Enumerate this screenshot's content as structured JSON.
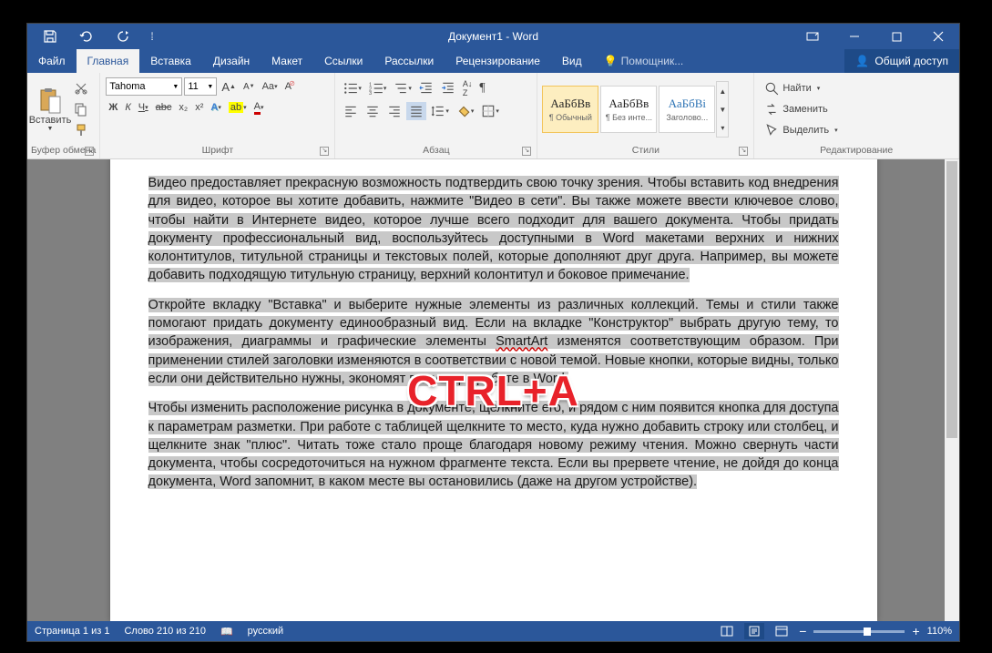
{
  "title": "Документ1 - Word",
  "tabs": {
    "file": "Файл",
    "home": "Главная",
    "insert": "Вставка",
    "design": "Дизайн",
    "layout": "Макет",
    "references": "Ссылки",
    "mailings": "Рассылки",
    "review": "Рецензирование",
    "view": "Вид",
    "tell": "Помощник...",
    "share": "Общий доступ"
  },
  "ribbon": {
    "clipboard": {
      "label": "Буфер обмена",
      "paste": "Вставить"
    },
    "font": {
      "label": "Шрифт",
      "name": "Tahoma",
      "size": "11",
      "bold": "Ж",
      "italic": "К",
      "underline": "Ч",
      "strike": "abc",
      "sub": "x₂",
      "sup": "x²"
    },
    "paragraph": {
      "label": "Абзац"
    },
    "styles": {
      "label": "Стили",
      "preview": "АаБбВв",
      "preview3": "АаБбВі",
      "s1": "¶ Обычный",
      "s2": "¶ Без инте...",
      "s3": "Заголово..."
    },
    "editing": {
      "label": "Редактирование",
      "find": "Найти",
      "replace": "Заменить",
      "select": "Выделить"
    }
  },
  "doc": {
    "p1": "Видео предоставляет прекрасную возможность подтвердить свою точку зрения. Чтобы вставить код внедрения для видео, которое вы хотите добавить, нажмите \"Видео в сети\". Вы также можете ввести ключевое слово, чтобы найти в Интернете видео, которое лучше всего подходит для вашего документа. Чтобы придать документу профессиональный вид, воспользуйтесь доступными в Word макетами верхних и нижних колонтитулов, титульной страницы и текстовых полей, которые дополняют друг друга. Например, вы можете добавить подходящую титульную страницу, верхний колонтитул и боковое примечание.",
    "p2a": "Откройте вкладку \"Вставка\" и выберите нужные элементы из различных коллекций. Темы и стили также помогают придать документу единообразный вид. Если на вкладке \"Конструктор\" выбрать другую тему, то изображения, диаграммы и графические элементы ",
    "p2b": "SmartArt",
    "p2c": " изменятся соответствующим образом. При применении стилей заголовки изменяются в соответствии с новой темой. Новые кнопки, которые видны, только если они действительно нужны, экономят время при работе в Word.",
    "p3": "Чтобы изменить расположение рисунка в документе, щелкните его, и рядом с ним появится кнопка для доступа к параметрам разметки. При работе с таблицей щелкните то место, куда нужно добавить строку или столбец, и щелкните знак \"плюс\". Читать тоже стало проще благодаря новому режиму чтения. Можно свернуть части документа, чтобы сосредоточиться на нужном фрагменте текста. Если вы прервете чтение, не дойдя до конца документа, Word запомнит, в каком месте вы остановились (даже на другом устройстве)."
  },
  "overlay": "CTRL+A",
  "status": {
    "page": "Страница 1 из 1",
    "words": "Слово 210 из 210",
    "lang": "русский",
    "zoom": "110%"
  }
}
